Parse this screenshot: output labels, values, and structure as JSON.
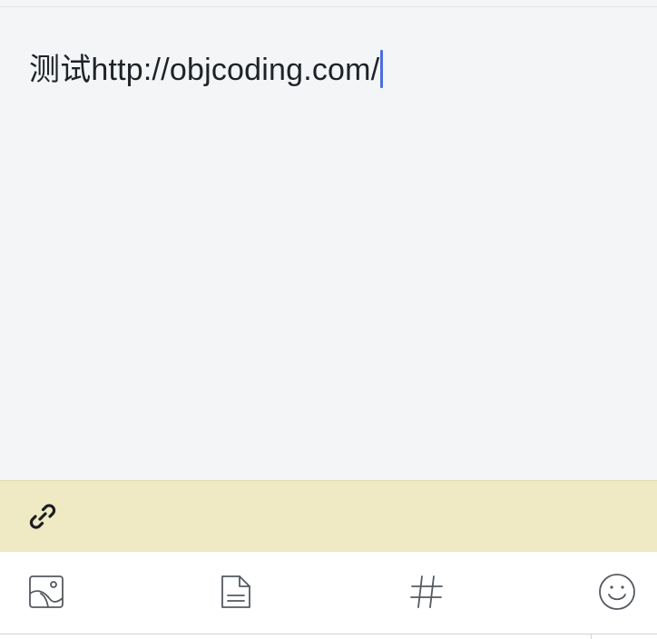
{
  "editor": {
    "content": "测试http://objcoding.com/",
    "caret_color": "#4a6ee0"
  },
  "link_bar": {
    "icon": "link-icon",
    "background": "#efe9c4"
  },
  "toolbar": {
    "items": [
      {
        "icon": "image-icon"
      },
      {
        "icon": "document-icon"
      },
      {
        "icon": "hashtag-icon"
      },
      {
        "icon": "smiley-icon"
      }
    ]
  },
  "colors": {
    "page_background": "#f3f5f7",
    "toolbar_background": "#ffffff",
    "icon_stroke": "#555a60"
  }
}
